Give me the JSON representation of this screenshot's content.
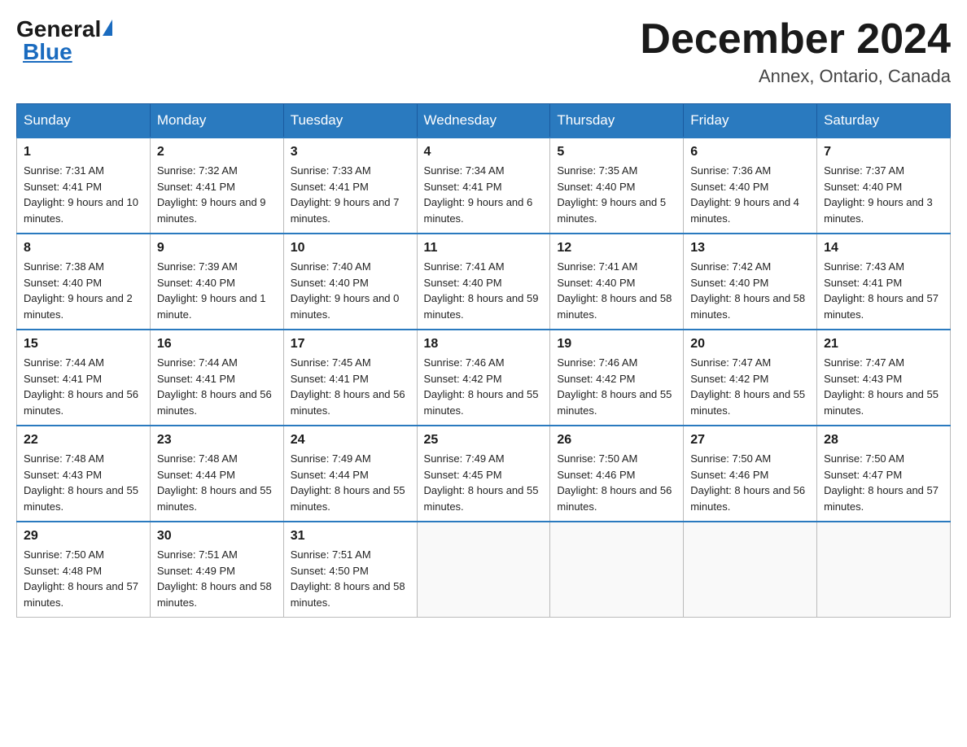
{
  "logo": {
    "general": "General",
    "blue": "Blue"
  },
  "header": {
    "title": "December 2024",
    "location": "Annex, Ontario, Canada"
  },
  "days_of_week": [
    "Sunday",
    "Monday",
    "Tuesday",
    "Wednesday",
    "Thursday",
    "Friday",
    "Saturday"
  ],
  "weeks": [
    [
      {
        "day": "1",
        "sunrise": "7:31 AM",
        "sunset": "4:41 PM",
        "daylight": "9 hours and 10 minutes."
      },
      {
        "day": "2",
        "sunrise": "7:32 AM",
        "sunset": "4:41 PM",
        "daylight": "9 hours and 9 minutes."
      },
      {
        "day": "3",
        "sunrise": "7:33 AM",
        "sunset": "4:41 PM",
        "daylight": "9 hours and 7 minutes."
      },
      {
        "day": "4",
        "sunrise": "7:34 AM",
        "sunset": "4:41 PM",
        "daylight": "9 hours and 6 minutes."
      },
      {
        "day": "5",
        "sunrise": "7:35 AM",
        "sunset": "4:40 PM",
        "daylight": "9 hours and 5 minutes."
      },
      {
        "day": "6",
        "sunrise": "7:36 AM",
        "sunset": "4:40 PM",
        "daylight": "9 hours and 4 minutes."
      },
      {
        "day": "7",
        "sunrise": "7:37 AM",
        "sunset": "4:40 PM",
        "daylight": "9 hours and 3 minutes."
      }
    ],
    [
      {
        "day": "8",
        "sunrise": "7:38 AM",
        "sunset": "4:40 PM",
        "daylight": "9 hours and 2 minutes."
      },
      {
        "day": "9",
        "sunrise": "7:39 AM",
        "sunset": "4:40 PM",
        "daylight": "9 hours and 1 minute."
      },
      {
        "day": "10",
        "sunrise": "7:40 AM",
        "sunset": "4:40 PM",
        "daylight": "9 hours and 0 minutes."
      },
      {
        "day": "11",
        "sunrise": "7:41 AM",
        "sunset": "4:40 PM",
        "daylight": "8 hours and 59 minutes."
      },
      {
        "day": "12",
        "sunrise": "7:41 AM",
        "sunset": "4:40 PM",
        "daylight": "8 hours and 58 minutes."
      },
      {
        "day": "13",
        "sunrise": "7:42 AM",
        "sunset": "4:40 PM",
        "daylight": "8 hours and 58 minutes."
      },
      {
        "day": "14",
        "sunrise": "7:43 AM",
        "sunset": "4:41 PM",
        "daylight": "8 hours and 57 minutes."
      }
    ],
    [
      {
        "day": "15",
        "sunrise": "7:44 AM",
        "sunset": "4:41 PM",
        "daylight": "8 hours and 56 minutes."
      },
      {
        "day": "16",
        "sunrise": "7:44 AM",
        "sunset": "4:41 PM",
        "daylight": "8 hours and 56 minutes."
      },
      {
        "day": "17",
        "sunrise": "7:45 AM",
        "sunset": "4:41 PM",
        "daylight": "8 hours and 56 minutes."
      },
      {
        "day": "18",
        "sunrise": "7:46 AM",
        "sunset": "4:42 PM",
        "daylight": "8 hours and 55 minutes."
      },
      {
        "day": "19",
        "sunrise": "7:46 AM",
        "sunset": "4:42 PM",
        "daylight": "8 hours and 55 minutes."
      },
      {
        "day": "20",
        "sunrise": "7:47 AM",
        "sunset": "4:42 PM",
        "daylight": "8 hours and 55 minutes."
      },
      {
        "day": "21",
        "sunrise": "7:47 AM",
        "sunset": "4:43 PM",
        "daylight": "8 hours and 55 minutes."
      }
    ],
    [
      {
        "day": "22",
        "sunrise": "7:48 AM",
        "sunset": "4:43 PM",
        "daylight": "8 hours and 55 minutes."
      },
      {
        "day": "23",
        "sunrise": "7:48 AM",
        "sunset": "4:44 PM",
        "daylight": "8 hours and 55 minutes."
      },
      {
        "day": "24",
        "sunrise": "7:49 AM",
        "sunset": "4:44 PM",
        "daylight": "8 hours and 55 minutes."
      },
      {
        "day": "25",
        "sunrise": "7:49 AM",
        "sunset": "4:45 PM",
        "daylight": "8 hours and 55 minutes."
      },
      {
        "day": "26",
        "sunrise": "7:50 AM",
        "sunset": "4:46 PM",
        "daylight": "8 hours and 56 minutes."
      },
      {
        "day": "27",
        "sunrise": "7:50 AM",
        "sunset": "4:46 PM",
        "daylight": "8 hours and 56 minutes."
      },
      {
        "day": "28",
        "sunrise": "7:50 AM",
        "sunset": "4:47 PM",
        "daylight": "8 hours and 57 minutes."
      }
    ],
    [
      {
        "day": "29",
        "sunrise": "7:50 AM",
        "sunset": "4:48 PM",
        "daylight": "8 hours and 57 minutes."
      },
      {
        "day": "30",
        "sunrise": "7:51 AM",
        "sunset": "4:49 PM",
        "daylight": "8 hours and 58 minutes."
      },
      {
        "day": "31",
        "sunrise": "7:51 AM",
        "sunset": "4:50 PM",
        "daylight": "8 hours and 58 minutes."
      },
      null,
      null,
      null,
      null
    ]
  ],
  "labels": {
    "sunrise": "Sunrise:",
    "sunset": "Sunset:",
    "daylight": "Daylight:"
  }
}
